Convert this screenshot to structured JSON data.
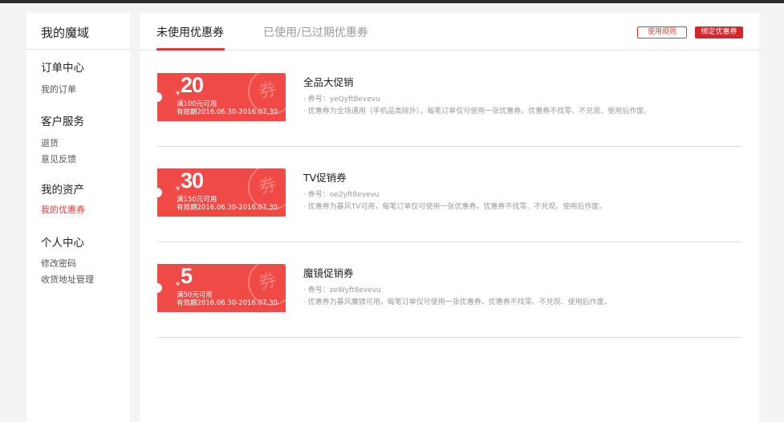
{
  "sidebar": {
    "title": "我的魔域",
    "groups": [
      {
        "title": "订单中心",
        "links": [
          "我的订单"
        ]
      },
      {
        "title": "客户服务",
        "links": [
          "退货",
          "意见反馈"
        ]
      },
      {
        "title": "我的资产",
        "links": [
          "我的优惠券"
        ]
      },
      {
        "title": "个人中心",
        "links": [
          "修改密码",
          "收货地址管理"
        ]
      }
    ],
    "active_link": "我的优惠券"
  },
  "tabs": {
    "unused": "未使用优惠券",
    "used": "已使用/已过期优惠券"
  },
  "buttons": {
    "rules": "使用规则",
    "bind": "绑定优惠券"
  },
  "coupons": [
    {
      "yen": "¥",
      "amount": "20",
      "condition": "满100元可用",
      "validity": "有效期2016.06.30-2016.07.30",
      "stamp": "券",
      "name": "全品大促销",
      "code": "· 券号：yeQyft8evevu",
      "desc": "· 优惠券为全场通用（手机品类除外），每笔订单仅可使用一张优惠券。优惠券不找零、不兑现、使用后作废。"
    },
    {
      "yen": "¥",
      "amount": "30",
      "condition": "满150元可用",
      "validity": "有效期2016.06.30-2016.07.30",
      "stamp": "券",
      "name": "TV促销券",
      "code": "· 券号：oe2yft8evevu",
      "desc": "· 优惠券为暴风TV可用，每笔订单仅可使用一张优惠券。优惠券不找零、不兑现、使用后作废。"
    },
    {
      "yen": "¥",
      "amount": "5",
      "condition": "满50元可用",
      "validity": "有效期2016.06.30-2016.07.30",
      "stamp": "券",
      "name": "魔镜促销券",
      "code": "· 券号：zeWyft8evevu",
      "desc": "· 优惠券为暴风魔镜可用，每笔订单仅可使用一张优惠券。优惠券不找零、不兑现、使用后作废。"
    }
  ],
  "colors": {
    "accent": "#e63a3a",
    "ticket": "#ef4a45",
    "bind_button": "#d6252c"
  }
}
